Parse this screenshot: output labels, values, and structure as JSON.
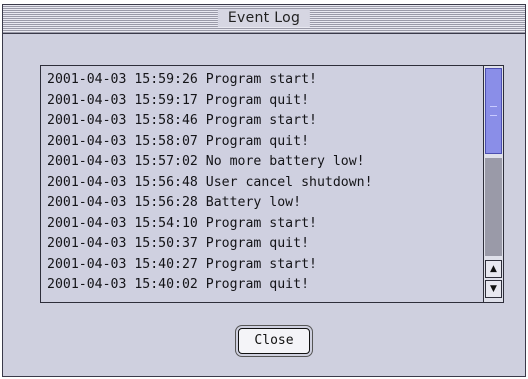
{
  "window": {
    "title": "Event Log"
  },
  "log": {
    "entries": [
      "2001-04-03 15:59:26 Program start!",
      "2001-04-03 15:59:17 Program quit!",
      "2001-04-03 15:58:46 Program start!",
      "2001-04-03 15:58:07 Program quit!",
      "2001-04-03 15:57:02 No more battery low!",
      "2001-04-03 15:56:48 User cancel shutdown!",
      "2001-04-03 15:56:28 Battery low!",
      "2001-04-03 15:54:10 Program start!",
      "2001-04-03 15:50:37 Program quit!",
      "2001-04-03 15:40:27 Program start!",
      "2001-04-03 15:40:02 Program quit!"
    ]
  },
  "scrollbar": {
    "up_icon": "▲",
    "down_icon": "▼"
  },
  "buttons": {
    "close_label": "Close"
  },
  "colors": {
    "window_bg": "#cfd0df",
    "scroll_thumb": "#8a8ee8"
  }
}
